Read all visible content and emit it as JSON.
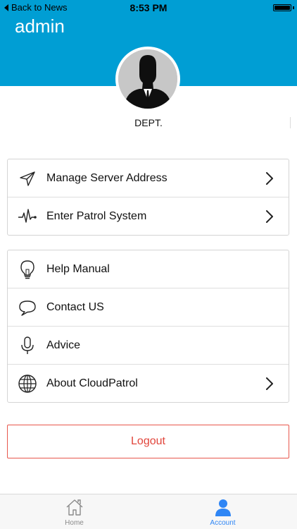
{
  "status_bar": {
    "back_label": "Back to News",
    "time": "8:53 PM"
  },
  "header": {
    "title": "admin",
    "background": "#009ed4"
  },
  "profile": {
    "department": "DEPT."
  },
  "menu_primary": [
    {
      "label": "Manage Server Address",
      "icon": "send-icon",
      "has_chevron": true
    },
    {
      "label": "Enter Patrol System",
      "icon": "pulse-icon",
      "has_chevron": true
    }
  ],
  "menu_secondary": [
    {
      "label": "Help Manual",
      "icon": "lightbulb-icon",
      "has_chevron": false
    },
    {
      "label": "Contact US",
      "icon": "chat-bubble-icon",
      "has_chevron": false
    },
    {
      "label": "Advice",
      "icon": "microphone-icon",
      "has_chevron": false
    },
    {
      "label": "About CloudPatrol",
      "icon": "globe-icon",
      "has_chevron": true
    }
  ],
  "logout": {
    "label": "Logout",
    "color": "#e1453b"
  },
  "tabbar": {
    "tabs": [
      {
        "label": "Home",
        "icon": "home-icon",
        "selected": false
      },
      {
        "label": "Account",
        "icon": "person-icon",
        "selected": true
      }
    ],
    "active_color": "#2f86f5"
  }
}
